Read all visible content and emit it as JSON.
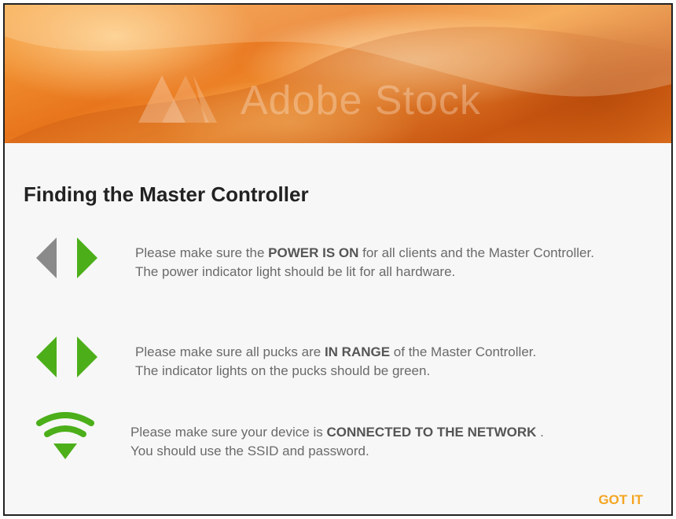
{
  "header": {
    "watermark": "Adobe Stock"
  },
  "dialog": {
    "title": "Finding the Master Controller",
    "items": [
      {
        "icon": "left-right-arrows-icon",
        "line1_pre": "Please make sure the ",
        "line1_bold": "POWER IS ON",
        "line1_post": " for all clients and the Master Controller.",
        "line2": "The power indicator light should be lit for all hardware."
      },
      {
        "icon": "left-right-arrows-icon",
        "line1_pre": "Please make sure all pucks are ",
        "line1_bold": "IN RANGE",
        "line1_post": " of the Master Controller.",
        "line2": "The indicator lights on the pucks should be green."
      },
      {
        "icon": "wifi-icon",
        "line1_pre": "Please make sure your device is ",
        "line1_bold": "CONNECTED TO THE NETWORK",
        "line1_post": " .",
        "line2": "You should use the SSID and password."
      }
    ],
    "got_it_label": "GOT IT"
  },
  "colors": {
    "accent": "#f5a623",
    "green": "#4caf1a",
    "gray": "#8a8a8a"
  }
}
